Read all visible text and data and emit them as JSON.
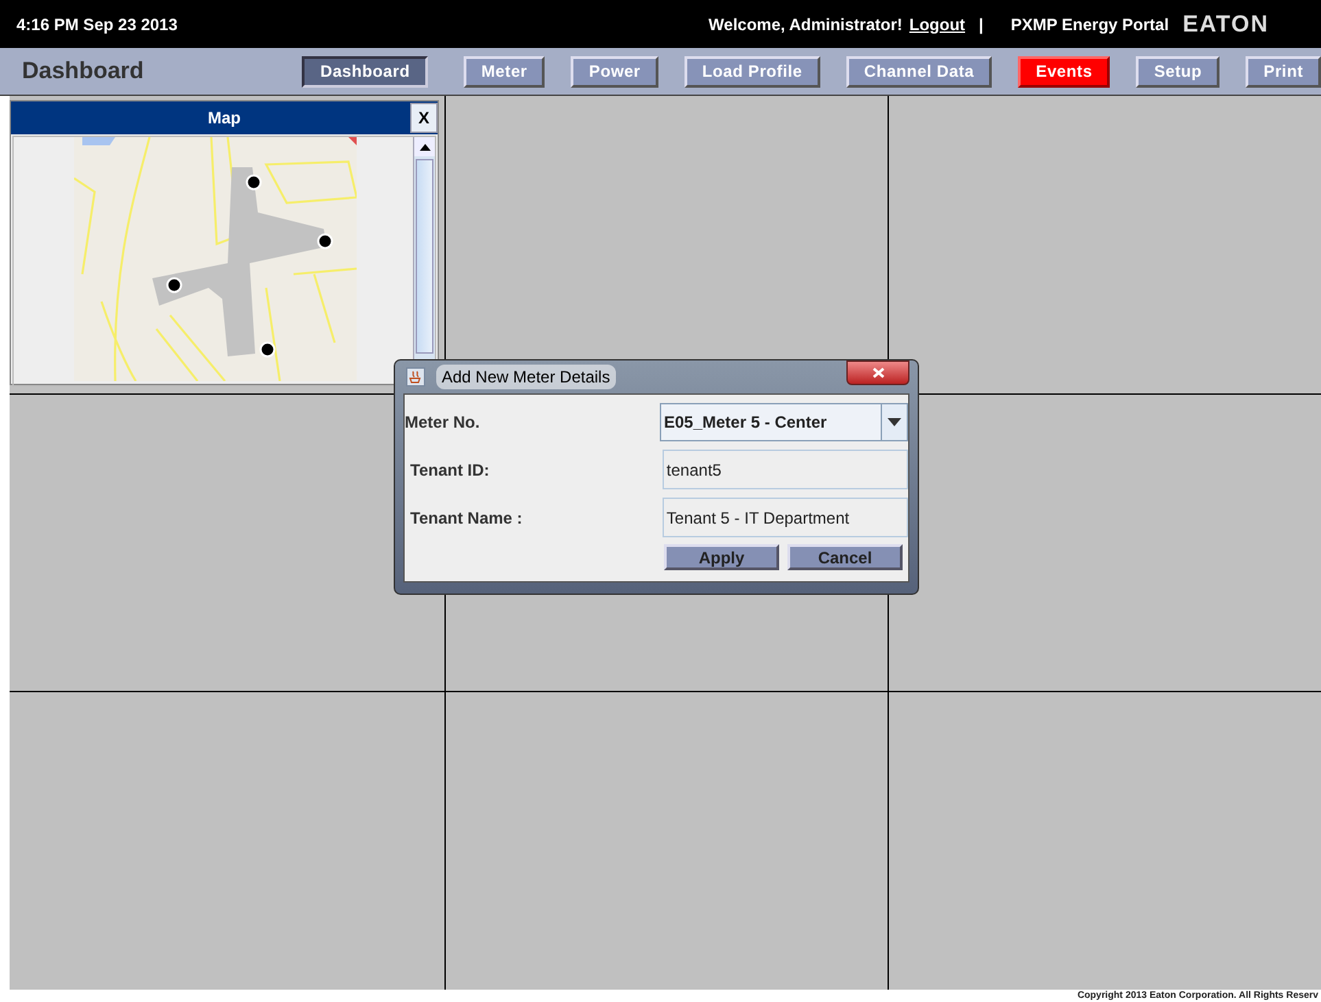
{
  "top_bar": {
    "datetime": "4:16 PM Sep 23 2013",
    "welcome": "Welcome, Administrator!",
    "logout": "Logout",
    "separator": "|",
    "portal": "PXMP Energy Portal",
    "logo": "EATON"
  },
  "header": {
    "title": "Dashboard"
  },
  "nav": [
    {
      "label": "Dashboard",
      "selected": true,
      "kind": "normal"
    },
    {
      "label": "Meter",
      "selected": false,
      "kind": "normal"
    },
    {
      "label": "Power",
      "selected": false,
      "kind": "normal"
    },
    {
      "label": "Load Profile",
      "selected": false,
      "kind": "normal"
    },
    {
      "label": "Channel Data",
      "selected": false,
      "kind": "normal"
    },
    {
      "label": "Events",
      "selected": false,
      "kind": "alert"
    },
    {
      "label": "Setup",
      "selected": false,
      "kind": "normal"
    },
    {
      "label": "Print",
      "selected": false,
      "kind": "normal"
    }
  ],
  "map_panel": {
    "title": "Map",
    "close": "X"
  },
  "dialog": {
    "title": "Add New Meter Details",
    "fields": [
      {
        "label": "Meter No.",
        "kind": "dropdown",
        "value": "E05_Meter 5 - Center"
      },
      {
        "label": "Tenant ID:",
        "kind": "text",
        "value": "tenant5"
      },
      {
        "label": "Tenant Name :",
        "kind": "text",
        "value": "Tenant 5 - IT Department"
      }
    ],
    "buttons": [
      "Apply",
      "Cancel"
    ]
  },
  "footer": {
    "copyright": "Copyright 2013 Eaton Corporation. All Rights Reserv"
  }
}
